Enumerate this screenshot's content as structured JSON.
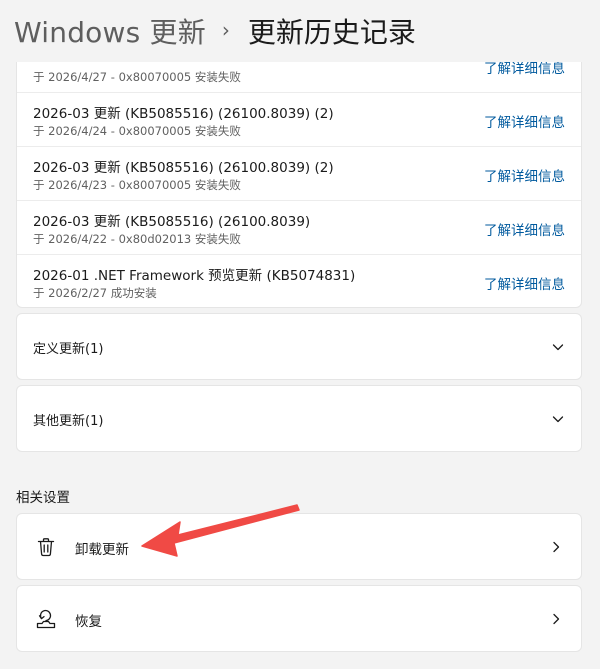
{
  "header": {
    "parent": "Windows 更新",
    "separator": "›",
    "current": "更新历史记录"
  },
  "history": {
    "items": [
      {
        "title": "",
        "status": "于 2026/4/27 - 0x80070005 安装失败",
        "link": "了解详细信息"
      },
      {
        "title": "2026-03 更新 (KB5085516) (26100.8039) (2)",
        "status": "于 2026/4/24 - 0x80070005 安装失败",
        "link": "了解详细信息"
      },
      {
        "title": "2026-03 更新 (KB5085516) (26100.8039) (2)",
        "status": "于 2026/4/23 - 0x80070005 安装失败",
        "link": "了解详细信息"
      },
      {
        "title": "2026-03 更新 (KB5085516) (26100.8039)",
        "status": "于 2026/4/22 - 0x80d02013 安装失败",
        "link": "了解详细信息"
      },
      {
        "title": "2026-01 .NET Framework 预览更新 (KB5074831)",
        "status": "于 2026/2/27 成功安装",
        "link": "了解详细信息"
      }
    ]
  },
  "expanders": {
    "definition": "定义更新(1)",
    "other": "其他更新(1)"
  },
  "related": {
    "title": "相关设置",
    "uninstall": "卸载更新",
    "recovery": "恢复"
  },
  "icons": {
    "uninstall": "trash-icon",
    "recovery": "recovery-icon",
    "expander": "chevron-down-icon",
    "card": "chevron-right-icon"
  },
  "colors": {
    "link": "#005a9e",
    "annotation_arrow": "#f04a45"
  }
}
